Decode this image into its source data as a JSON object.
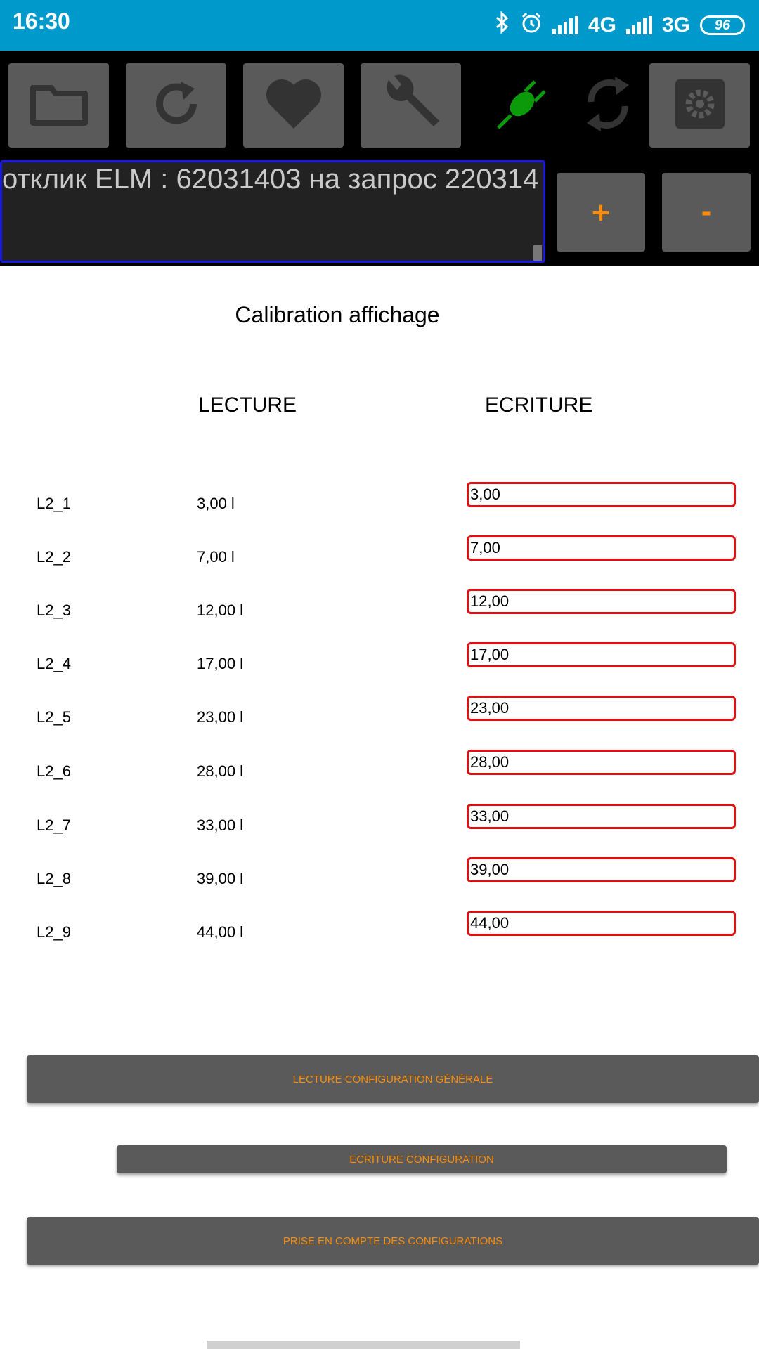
{
  "status_bar": {
    "time": "16:30",
    "network1": "4G",
    "network2": "3G",
    "battery": "96"
  },
  "toolbar": {
    "buttons": [
      "folder-icon",
      "refresh-icon",
      "heart-icon",
      "wrench-icon",
      "plug-connected-icon",
      "sync-icon",
      "gear-icon"
    ]
  },
  "response": {
    "text": "отклик ELM : 62031403 на запрос 220314"
  },
  "zoom": {
    "plus": "+",
    "minus": "-"
  },
  "page": {
    "title": "Calibration affichage",
    "col_read": "LECTURE",
    "col_write": "ECRITURE"
  },
  "rows": [
    {
      "name": "L2_1",
      "read": "3,00 l",
      "write": "3,00"
    },
    {
      "name": "L2_2",
      "read": "7,00 l",
      "write": "7,00"
    },
    {
      "name": "L2_3",
      "read": "12,00 l",
      "write": "12,00"
    },
    {
      "name": "L2_4",
      "read": "17,00 l",
      "write": "17,00"
    },
    {
      "name": "L2_5",
      "read": "23,00 l",
      "write": "23,00"
    },
    {
      "name": "L2_6",
      "read": "28,00 l",
      "write": "28,00"
    },
    {
      "name": "L2_7",
      "read": "33,00 l",
      "write": "33,00"
    },
    {
      "name": "L2_8",
      "read": "39,00 l",
      "write": "39,00"
    },
    {
      "name": "L2_9",
      "read": "44,00 l",
      "write": "44,00"
    }
  ],
  "actions": {
    "read_config": "LECTURE CONFIGURATION GÉNÉRALE",
    "write_config": "ECRITURE CONFIGURATION",
    "apply_config": "PRISE EN COMPTE DES CONFIGURATIONS"
  },
  "colors": {
    "status_bar": "#0099cc",
    "accent": "#ff8c00",
    "input_border": "#e01010",
    "button_bg": "#5a5a5a"
  }
}
